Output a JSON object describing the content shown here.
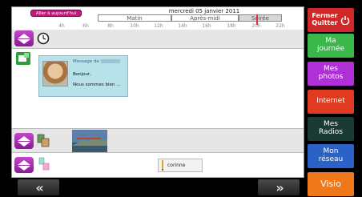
{
  "header": {
    "today_button": "Aller à aujourd'hui",
    "date": "mercredi 05 janvier 2011",
    "periods": [
      "Matin",
      "Après-midi",
      "Soirée"
    ]
  },
  "hours": [
    "4h",
    "6h",
    "8h",
    "10h",
    "12h",
    "14h",
    "16h",
    "18h",
    "20h",
    "22h"
  ],
  "message": {
    "from_label": "Message de",
    "line1": "Bonjour,",
    "line2": "Nous sommes bien ..."
  },
  "contact_note": "corinne",
  "sidebar": {
    "quit": "Fermer\nQuitter",
    "my_day": "Ma\njournée",
    "my_photos": "Mes\nphotos",
    "internet": "Internet",
    "my_radios": "Mes\nRadios",
    "my_network": "Mon\nréseau",
    "visio": "Visio"
  },
  "colors": {
    "accent_magenta": "#b03ab8",
    "quit_red": "#d02828",
    "my_day_green": "#3ab84a",
    "my_photos_purple": "#b030d8",
    "internet_red": "#e03a20",
    "radios_dark": "#1a3a34",
    "network_blue": "#2a62c8",
    "visio_orange": "#f07818"
  },
  "icons": {
    "prev": "double-chevron-left-icon",
    "next": "double-chevron-right-icon",
    "clock": "clock-icon",
    "quit": "power-icon",
    "add_message": "add-message-icon"
  }
}
